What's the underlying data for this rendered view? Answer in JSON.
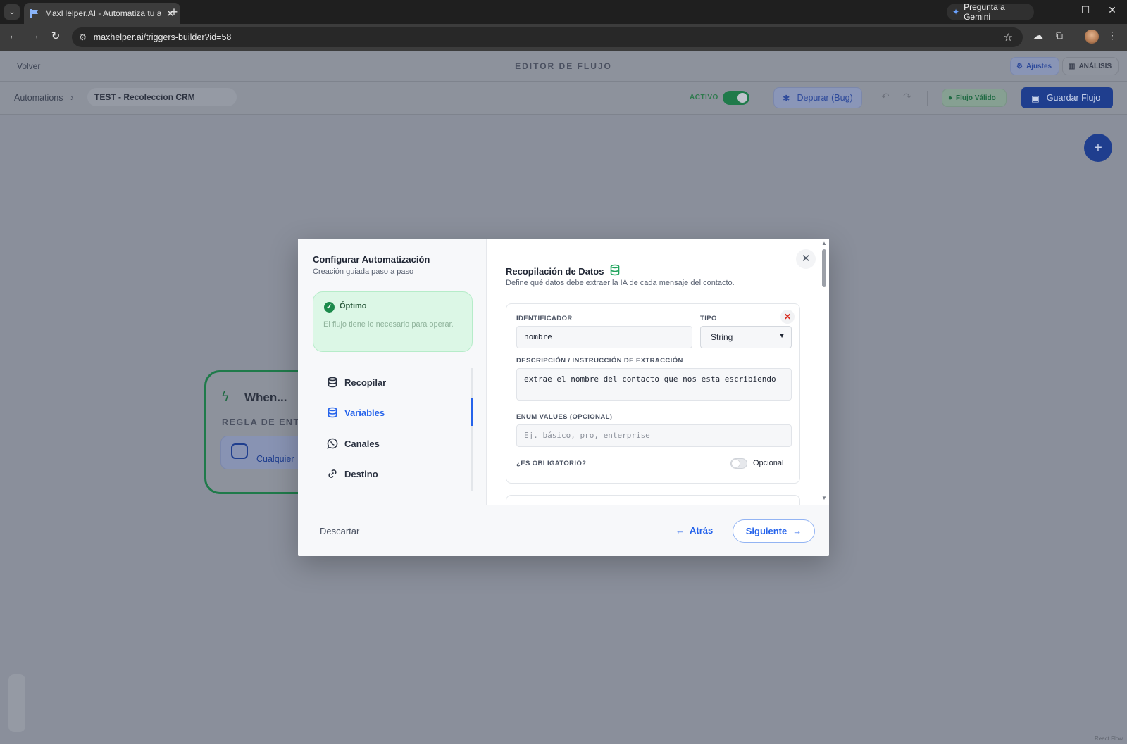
{
  "browser": {
    "tab_title": "MaxHelper.AI - Automatiza tu a",
    "url": "maxhelper.ai/triggers-builder?id=58",
    "gemini_label": "Pregunta a Gemini"
  },
  "header": {
    "back_label": "Volver",
    "editor_title": "EDITOR DE FLUJO",
    "settings_label": "Ajustes",
    "analytics_label": "ANÁLISIS"
  },
  "toolbar": {
    "breadcrumb_root": "Automations",
    "flow_name": "TEST - Recoleccion CRM",
    "active_label": "ACTIVO",
    "debug_label": "Depurar (Bug)",
    "valid_label": "Flujo Válido",
    "save_label": "Guardar Flujo"
  },
  "node": {
    "title": "When...",
    "rule_label": "REGLA DE ENTR",
    "chip_label": "Cualquier"
  },
  "modal": {
    "side_title": "Configurar Automatización",
    "side_subtitle": "Creación guiada paso a paso",
    "status_title": "Óptimo",
    "status_text": "El flujo tiene lo necesario para operar.",
    "steps": [
      {
        "label": "Recopilar",
        "icon": "database-icon",
        "active": false
      },
      {
        "label": "Variables",
        "icon": "database-icon",
        "active": true
      },
      {
        "label": "Canales",
        "icon": "whatsapp-icon",
        "active": false
      },
      {
        "label": "Destino",
        "icon": "link-icon",
        "active": false
      }
    ],
    "content_title": "Recopilación de Datos",
    "content_subtitle": "Define qué datos debe extraer la IA de cada mensaje del contacto.",
    "variable": {
      "identifier_label": "IDENTIFICADOR",
      "identifier_value": "nombre",
      "type_label": "TIPO",
      "type_value": "String",
      "description_label": "DESCRIPCIÓN / INSTRUCCIÓN DE EXTRACCIÓN",
      "description_value": "extrae el nombre del contacto que nos esta escribiendo",
      "enum_label": "ENUM VALUES (OPCIONAL)",
      "enum_placeholder": "Ej. básico, pro, enterprise",
      "required_label": "¿ES OBLIGATORIO?",
      "required_state_label": "Opcional"
    },
    "discard_label": "Descartar",
    "back_label": "Atrás",
    "next_label": "Siguiente"
  },
  "canvas": {
    "attribution": "React Flow"
  },
  "colors": {
    "accent": "#2563eb",
    "success": "#1b8a4b",
    "danger": "#d92d20",
    "navy": "#1f3e8e"
  }
}
